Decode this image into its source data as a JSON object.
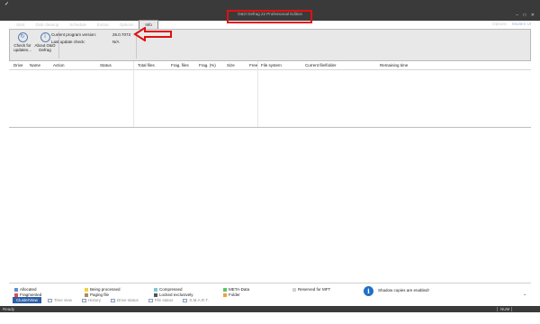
{
  "window": {
    "title": "O&O Defrag 22 Professional Edition",
    "controls": [
      "–",
      "□",
      "✕"
    ]
  },
  "tabs": [
    "Start",
    "Disk cleanup",
    "Schedule",
    "Extras",
    "Options",
    "Info"
  ],
  "active_tab": "Info",
  "topright": {
    "options": "Options",
    "mode": "Modern UI"
  },
  "ribbon": {
    "check_updates": "Check for updates...",
    "about": "About O&O Defrag",
    "version_label": "Current program version:",
    "version_value": "26.0.7073",
    "last_update_label": "Last update check:",
    "last_update_value": "N/A"
  },
  "columns": [
    "Drive",
    "Name",
    "Action",
    "Status",
    "Total files",
    "Frag. files",
    "Frag. (%)",
    "Size",
    "Free",
    "File system",
    "Current file/folder",
    "Remaining time"
  ],
  "legend": [
    {
      "label": "Allocated",
      "color": "#5b8fd6"
    },
    {
      "label": "Fragmented",
      "color": "#e05050"
    },
    {
      "label": "Being processed",
      "color": "#f0d23c"
    },
    {
      "label": "Paging file",
      "color": "#b08a60"
    },
    {
      "label": "Compressed",
      "color": "#7ec8d8"
    },
    {
      "label": "Locked exclusively",
      "color": "#555555"
    },
    {
      "label": "META-Data",
      "color": "#5ec46a"
    },
    {
      "label": "Folder",
      "color": "#f0a040"
    },
    {
      "label": "Reserved for MFT",
      "color": "#d0d0d0"
    }
  ],
  "shadow_notice": "Shadow copies are enabled!",
  "view_tabs": [
    "ClusterView",
    "Time view",
    "History",
    "Drive status",
    "File status",
    "S.M.A.R.T."
  ],
  "active_view": "ClusterView",
  "status": {
    "text": "Ready",
    "num": "NUM"
  }
}
